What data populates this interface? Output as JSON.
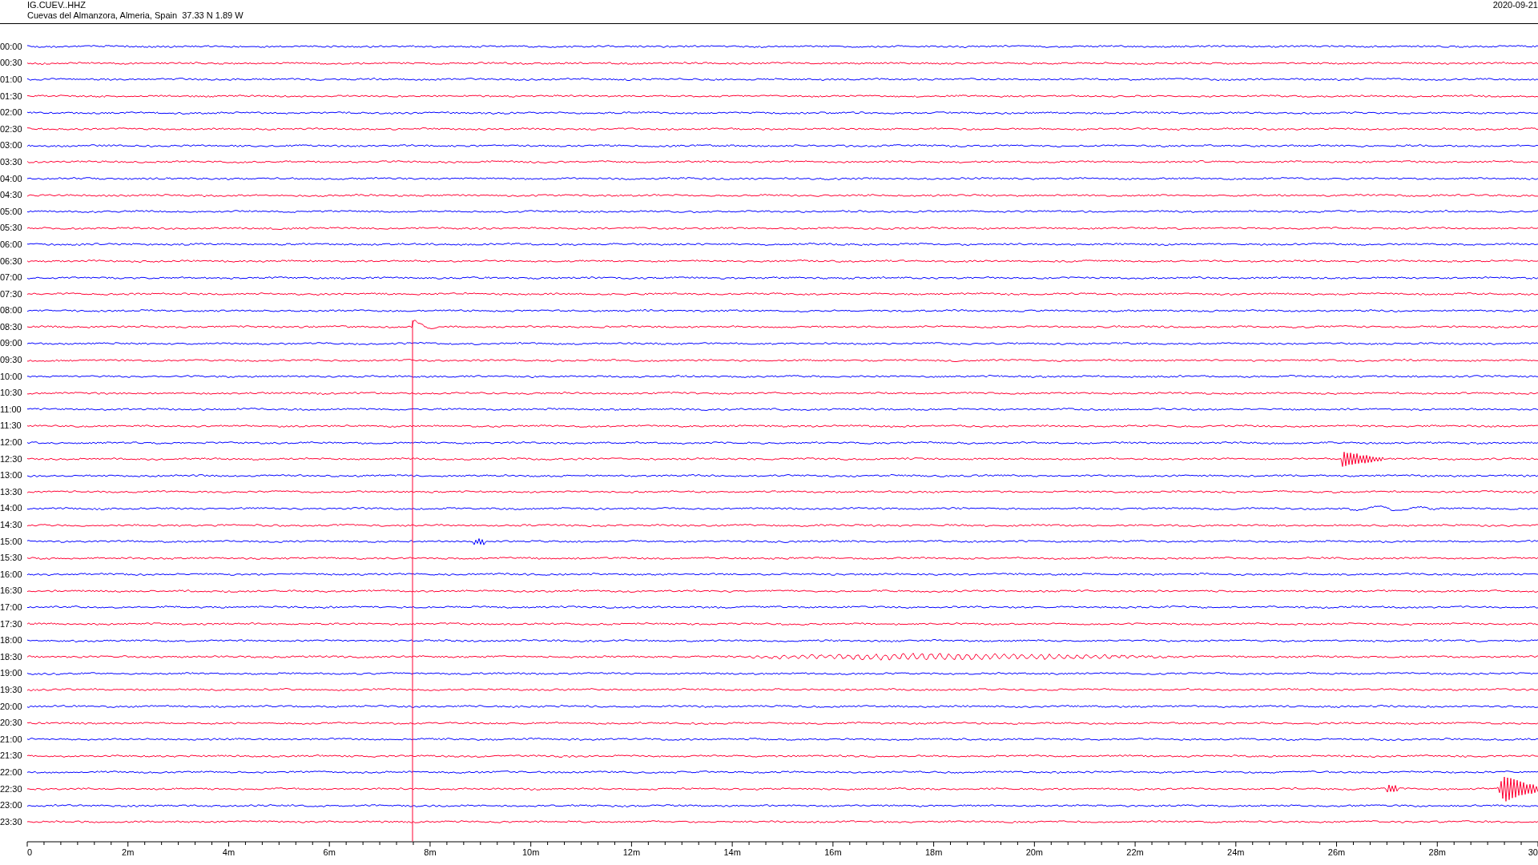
{
  "header": {
    "station": "IG.CUEV..HHZ",
    "location": "Cuevas del Almanzora, Almeria, Spain  37.33 N 1.89 W",
    "date": "2020-09-21"
  },
  "rows": [
    {
      "label": "00:00",
      "color": "#0000ff"
    },
    {
      "label": "00:30",
      "color": "#ff0033"
    },
    {
      "label": "01:00",
      "color": "#0000ff"
    },
    {
      "label": "01:30",
      "color": "#ff0033"
    },
    {
      "label": "02:00",
      "color": "#0000ff"
    },
    {
      "label": "02:30",
      "color": "#ff0033"
    },
    {
      "label": "03:00",
      "color": "#0000ff"
    },
    {
      "label": "03:30",
      "color": "#ff0033"
    },
    {
      "label": "04:00",
      "color": "#0000ff"
    },
    {
      "label": "04:30",
      "color": "#ff0033"
    },
    {
      "label": "05:00",
      "color": "#0000ff"
    },
    {
      "label": "05:30",
      "color": "#ff0033"
    },
    {
      "label": "06:00",
      "color": "#0000ff"
    },
    {
      "label": "06:30",
      "color": "#ff0033"
    },
    {
      "label": "07:00",
      "color": "#0000ff"
    },
    {
      "label": "07:30",
      "color": "#ff0033"
    },
    {
      "label": "08:00",
      "color": "#0000ff"
    },
    {
      "label": "08:30",
      "color": "#ff0033"
    },
    {
      "label": "09:00",
      "color": "#0000ff"
    },
    {
      "label": "09:30",
      "color": "#ff0033"
    },
    {
      "label": "10:00",
      "color": "#0000ff"
    },
    {
      "label": "10:30",
      "color": "#ff0033"
    },
    {
      "label": "11:00",
      "color": "#0000ff"
    },
    {
      "label": "11:30",
      "color": "#ff0033"
    },
    {
      "label": "12:00",
      "color": "#0000ff"
    },
    {
      "label": "12:30",
      "color": "#ff0033"
    },
    {
      "label": "13:00",
      "color": "#0000ff"
    },
    {
      "label": "13:30",
      "color": "#ff0033"
    },
    {
      "label": "14:00",
      "color": "#0000ff"
    },
    {
      "label": "14:30",
      "color": "#ff0033"
    },
    {
      "label": "15:00",
      "color": "#0000ff"
    },
    {
      "label": "15:30",
      "color": "#ff0033"
    },
    {
      "label": "16:00",
      "color": "#0000ff"
    },
    {
      "label": "16:30",
      "color": "#ff0033"
    },
    {
      "label": "17:00",
      "color": "#0000ff"
    },
    {
      "label": "17:30",
      "color": "#ff0033"
    },
    {
      "label": "18:00",
      "color": "#0000ff"
    },
    {
      "label": "18:30",
      "color": "#ff0033"
    },
    {
      "label": "19:00",
      "color": "#0000ff"
    },
    {
      "label": "19:30",
      "color": "#ff0033"
    },
    {
      "label": "20:00",
      "color": "#0000ff"
    },
    {
      "label": "20:30",
      "color": "#ff0033"
    },
    {
      "label": "21:00",
      "color": "#0000ff"
    },
    {
      "label": "21:30",
      "color": "#ff0033"
    },
    {
      "label": "22:00",
      "color": "#0000ff"
    },
    {
      "label": "22:30",
      "color": "#ff0033"
    },
    {
      "label": "23:00",
      "color": "#0000ff"
    },
    {
      "label": "23:30",
      "color": "#ff0033"
    }
  ],
  "x_axis": {
    "ticks": [
      "0",
      "2m",
      "4m",
      "6m",
      "8m",
      "10m",
      "12m",
      "14m",
      "16m",
      "18m",
      "20m",
      "22m",
      "24m",
      "26m",
      "28m",
      "30"
    ]
  }
}
